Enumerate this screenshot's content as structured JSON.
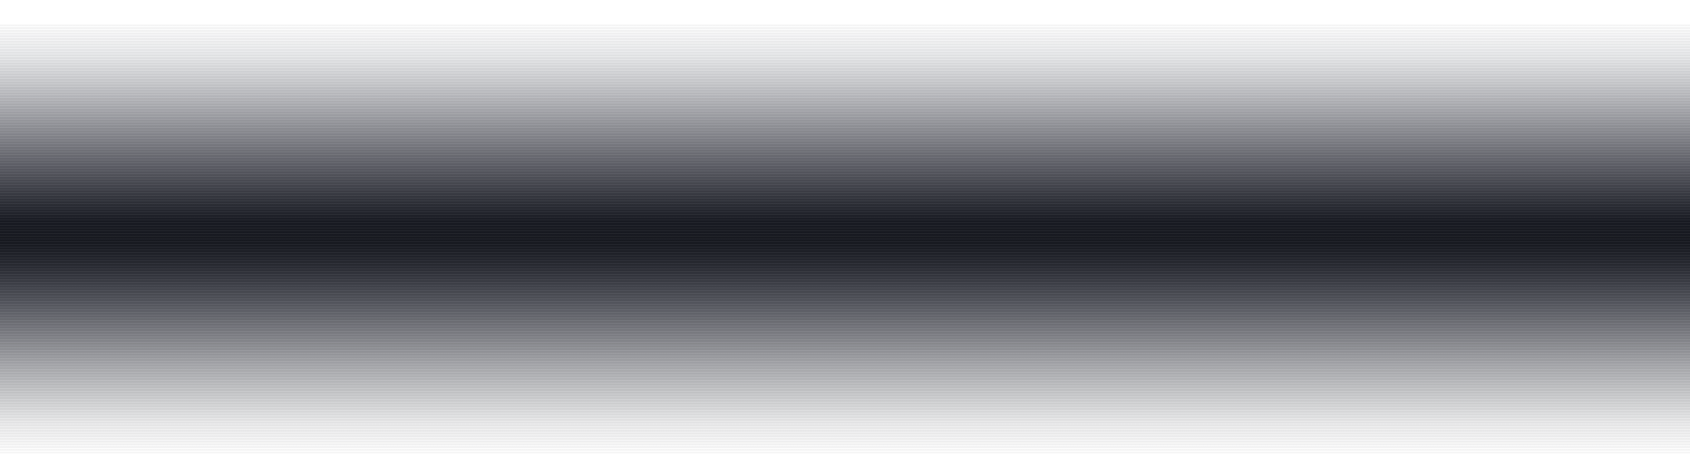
{
  "image": {
    "colors": {
      "background": "#ffffff",
      "band_center": "#181a21",
      "band_edge": "#ffffff"
    }
  }
}
